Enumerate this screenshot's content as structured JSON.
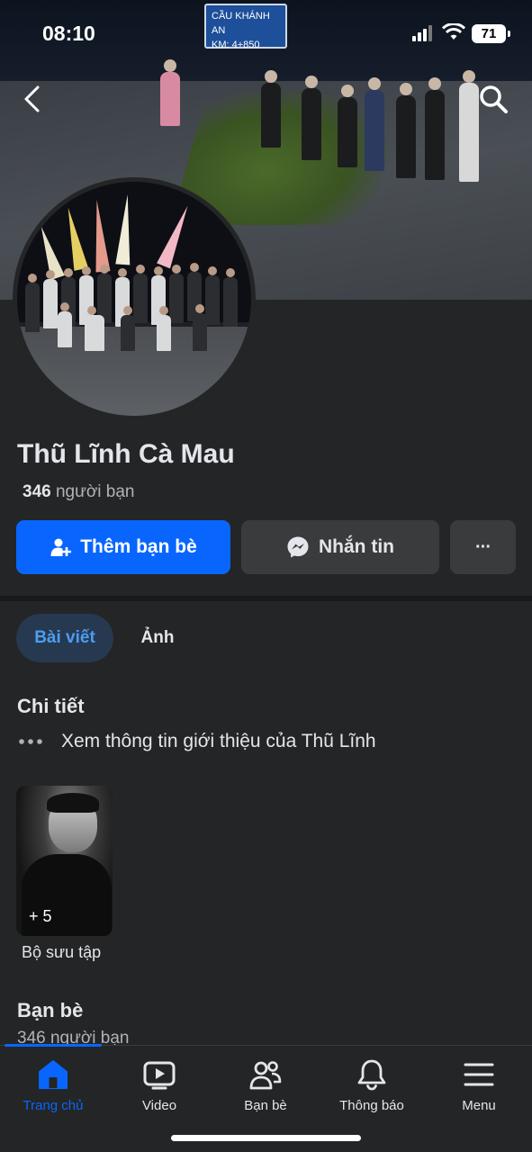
{
  "status_bar": {
    "time": "08:10",
    "battery": "71"
  },
  "cover": {
    "sign_line1": "CẦU KHÁNH AN",
    "sign_line2": "KM: 4+850"
  },
  "profile": {
    "name": "Thũ Lĩnh Cà Mau",
    "friends_count": "346",
    "friends_suffix": "người bạn"
  },
  "actions": {
    "add_friend": "Thêm bạn bè",
    "message": "Nhắn tin",
    "more": "···"
  },
  "tabs": [
    {
      "label": "Bài viết",
      "active": true
    },
    {
      "label": "Ảnh",
      "active": false
    }
  ],
  "details": {
    "title": "Chi tiết",
    "intro_text": "Xem thông tin giới thiệu của Thũ Lĩnh"
  },
  "collection": {
    "count_label": "+ 5",
    "label": "Bộ sưu tập"
  },
  "friends_section": {
    "title": "Bạn bè",
    "subtitle": "346 người bạn"
  },
  "bottom_nav": [
    {
      "label": "Trang chủ",
      "icon": "home-icon",
      "active": true
    },
    {
      "label": "Video",
      "icon": "video-icon",
      "active": false
    },
    {
      "label": "Bạn bè",
      "icon": "friends-icon",
      "active": false
    },
    {
      "label": "Thông báo",
      "icon": "bell-icon",
      "active": false
    },
    {
      "label": "Menu",
      "icon": "menu-icon",
      "active": false
    }
  ],
  "colors": {
    "accent": "#0866ff",
    "background": "#242526",
    "button_gray": "#3a3b3c"
  }
}
